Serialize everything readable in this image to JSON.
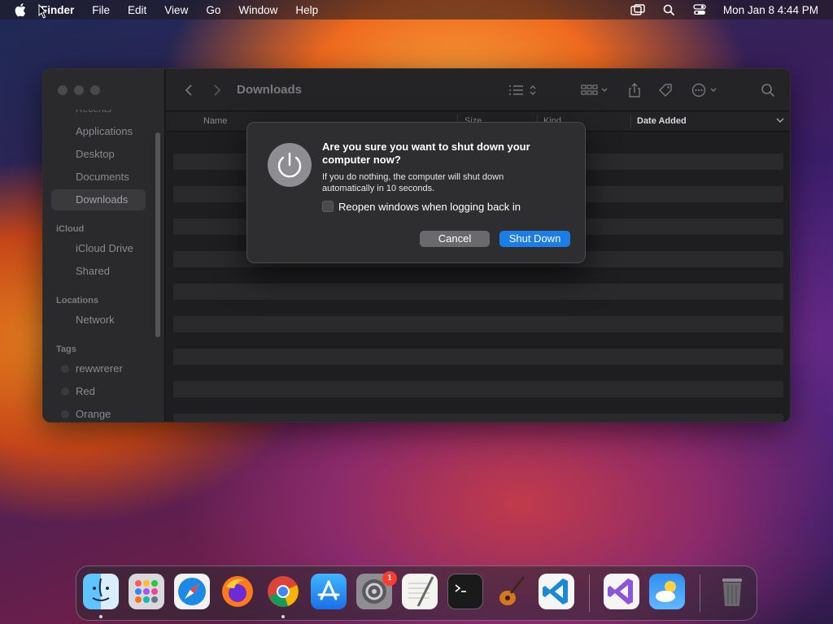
{
  "menubar": {
    "app_name": "Finder",
    "menus": [
      "File",
      "Edit",
      "View",
      "Go",
      "Window",
      "Help"
    ],
    "clock": "Mon Jan 8  4:44 PM"
  },
  "finder": {
    "title": "Downloads",
    "sidebar": {
      "cut_item": "Recents",
      "favorites": [
        "Applications",
        "Desktop",
        "Documents",
        "Downloads"
      ],
      "icloud_header": "iCloud",
      "icloud": [
        "iCloud Drive",
        "Shared"
      ],
      "locations_header": "Locations",
      "locations": [
        "Network"
      ],
      "tags_header": "Tags",
      "tags": [
        "rewwrerer",
        "Red",
        "Orange"
      ]
    },
    "columns": {
      "name": "Name",
      "size": "Size",
      "kind": "Kind",
      "date_added": "Date Added"
    }
  },
  "dialog": {
    "title": "Are you sure you want to shut down your computer now?",
    "message": "If you do nothing, the computer will shut down automatically in 10 seconds.",
    "checkbox_label": "Reopen windows when logging back in",
    "checkbox_checked": false,
    "cancel_label": "Cancel",
    "confirm_label": "Shut Down"
  },
  "dock": {
    "apps": [
      "Finder",
      "Launchpad",
      "Safari",
      "Firefox",
      "Chrome",
      "App Store",
      "System Settings",
      "TextEdit",
      "Terminal",
      "GarageBand",
      "Visual Studio Code",
      "Visual Studio",
      "Weather",
      "Trash"
    ],
    "settings_badge": "1"
  },
  "colors": {
    "accent": "#1b7ee6",
    "badge": "#ff3b30"
  }
}
